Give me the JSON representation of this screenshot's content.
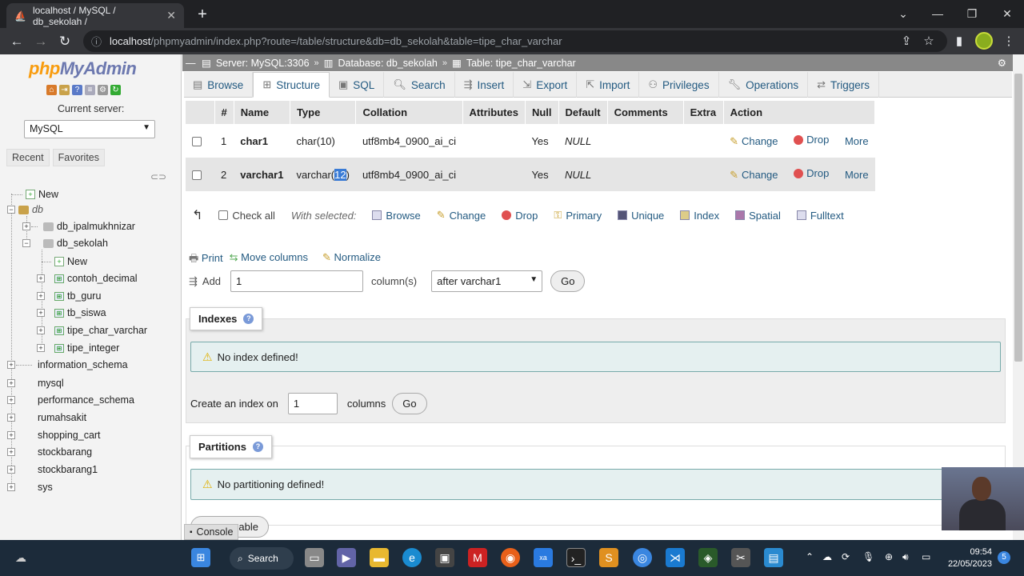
{
  "browser": {
    "tab_title": "localhost / MySQL / db_sekolah /",
    "url_host": "localhost",
    "url_path": "/phpmyadmin/index.php?route=/table/structure&db=db_sekolah&table=tipe_char_varchar"
  },
  "logo": {
    "php": "php",
    "myadmin": "MyAdmin"
  },
  "left": {
    "current_server_label": "Current server:",
    "server_select": "MySQL",
    "recent": "Recent",
    "favorites": "Favorites",
    "tree": {
      "new_root": "New",
      "group": "db",
      "db_ipalmukhnizar": "db_ipalmukhnizar",
      "db_sekolah": "db_sekolah",
      "new_table": "New",
      "tables": [
        "contoh_decimal",
        "tb_guru",
        "tb_siswa",
        "tipe_char_varchar",
        "tipe_integer"
      ],
      "others": [
        "information_schema",
        "mysql",
        "performance_schema",
        "rumahsakit",
        "shopping_cart",
        "stockbarang",
        "stockbarang1",
        "sys"
      ]
    }
  },
  "breadcrumb": {
    "server": "Server: MySQL:3306",
    "database": "Database: db_sekolah",
    "table": "Table: tipe_char_varchar"
  },
  "tabs": [
    "Browse",
    "Structure",
    "SQL",
    "Search",
    "Insert",
    "Export",
    "Import",
    "Privileges",
    "Operations",
    "Triggers"
  ],
  "table": {
    "headers": [
      "#",
      "Name",
      "Type",
      "Collation",
      "Attributes",
      "Null",
      "Default",
      "Comments",
      "Extra",
      "Action"
    ],
    "rows": [
      {
        "num": "1",
        "name": "char1",
        "type": "char(10)",
        "type_prefix": "",
        "type_hl": "",
        "type_suffix": "",
        "collation": "utf8mb4_0900_ai_ci",
        "null": "Yes",
        "default": "NULL"
      },
      {
        "num": "2",
        "name": "varchar1",
        "type": "",
        "type_prefix": "varchar(",
        "type_hl": "12",
        "type_suffix": ")",
        "collation": "utf8mb4_0900_ai_ci",
        "null": "Yes",
        "default": "NULL"
      }
    ],
    "actions": {
      "change": "Change",
      "drop": "Drop",
      "more": "More"
    }
  },
  "with_selected": {
    "check_all": "Check all",
    "label": "With selected:",
    "items": [
      "Browse",
      "Change",
      "Drop",
      "Primary",
      "Unique",
      "Index",
      "Spatial",
      "Fulltext"
    ]
  },
  "tools": {
    "print": "Print",
    "move_columns": "Move columns",
    "normalize": "Normalize"
  },
  "add": {
    "label": "Add",
    "value": "1",
    "columns_label": "column(s)",
    "position": "after varchar1",
    "go": "Go"
  },
  "indexes": {
    "title": "Indexes",
    "notice": "No index defined!",
    "create_label": "Create an index on",
    "create_value": "1",
    "columns_label": "columns",
    "go": "Go"
  },
  "partitions": {
    "title": "Partitions",
    "notice": "No partitioning defined!",
    "partition_button": "able"
  },
  "console": "Console",
  "taskbar": {
    "search": "Search",
    "time": "09:54",
    "date": "22/05/2023",
    "badge": "5"
  }
}
